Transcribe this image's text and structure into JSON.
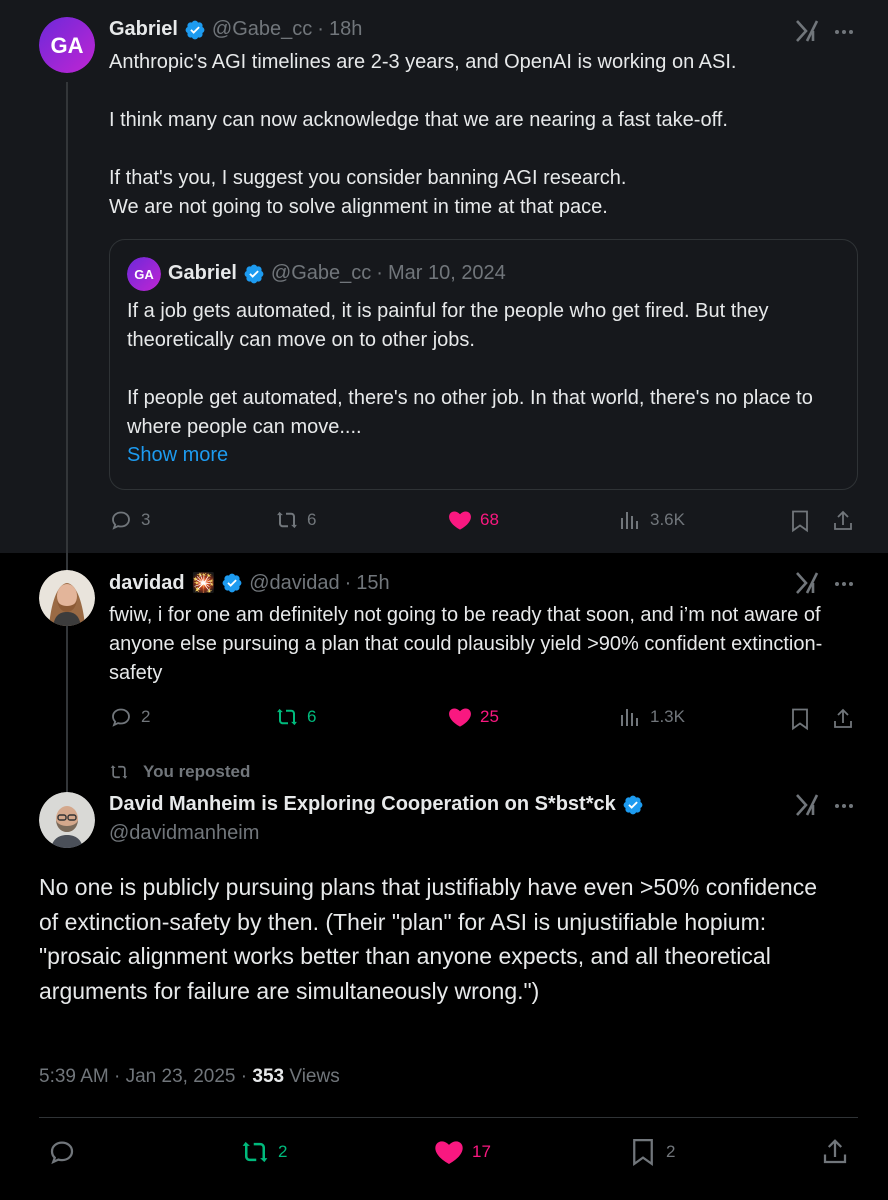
{
  "post1": {
    "avatar_initials": "GA",
    "name": "Gabriel",
    "handle": "@Gabe_cc",
    "separator": "·",
    "time": "18h",
    "text": "Anthropic's AGI timelines are 2-3 years, and OpenAI is working on ASI.\n\nI think many can now acknowledge that we are nearing a fast take-off.\n\nIf that's you, I suggest you consider banning AGI research.\nWe are not going to solve alignment in time at that pace.",
    "quote": {
      "avatar_initials": "GA",
      "name": "Gabriel",
      "handle": "@Gabe_cc",
      "separator": "·",
      "date": "Mar 10, 2024",
      "text": "If a job gets automated, it is painful for the people who get fired. But they theoretically can move on to other jobs.\n\nIf people get automated, there's no other job. In that world, there's no place to where people can move....",
      "show_more": "Show more"
    },
    "replies": "3",
    "reposts": "6",
    "likes": "68",
    "views": "3.6K"
  },
  "post2": {
    "name": "davidad",
    "emoji": "🎇",
    "handle": "@davidad",
    "separator": "·",
    "time": "15h",
    "text": "fwiw, i for one am definitely not going to be ready that soon, and i’m not aware of anyone else pursuing a plan that could plausibly yield >90% confident extinction-safety",
    "replies": "2",
    "reposts": "6",
    "likes": "25",
    "views": "1.3K"
  },
  "post3": {
    "repost_note": "You reposted",
    "name": "David Manheim is Exploring Cooperation on S*bst*ck",
    "handle": "@davidmanheim",
    "text": "No one is publicly pursuing plans that justifiably have even >50% confidence of extinction-safety by then. (Their \"plan\" for ASI is unjustifiable hopium: \"prosaic alignment works better than anyone expects, and all theoretical arguments for failure are simultaneously wrong.\")",
    "time": "5:39 AM",
    "separator": "·",
    "date": "Jan 23, 2025",
    "views_count": "353",
    "views_label": "Views",
    "reposts": "2",
    "likes": "17",
    "bookmarks": "2"
  },
  "colors": {
    "accent": "#1d9bf0",
    "like": "#f91880",
    "repost": "#00ba7c",
    "muted": "#71767b",
    "text": "#e7e9ea"
  },
  "icons": [
    "verified-badge-icon",
    "grok-icon",
    "more-icon",
    "reply-icon",
    "repost-icon",
    "like-icon",
    "views-icon",
    "bookmark-icon",
    "share-icon"
  ]
}
